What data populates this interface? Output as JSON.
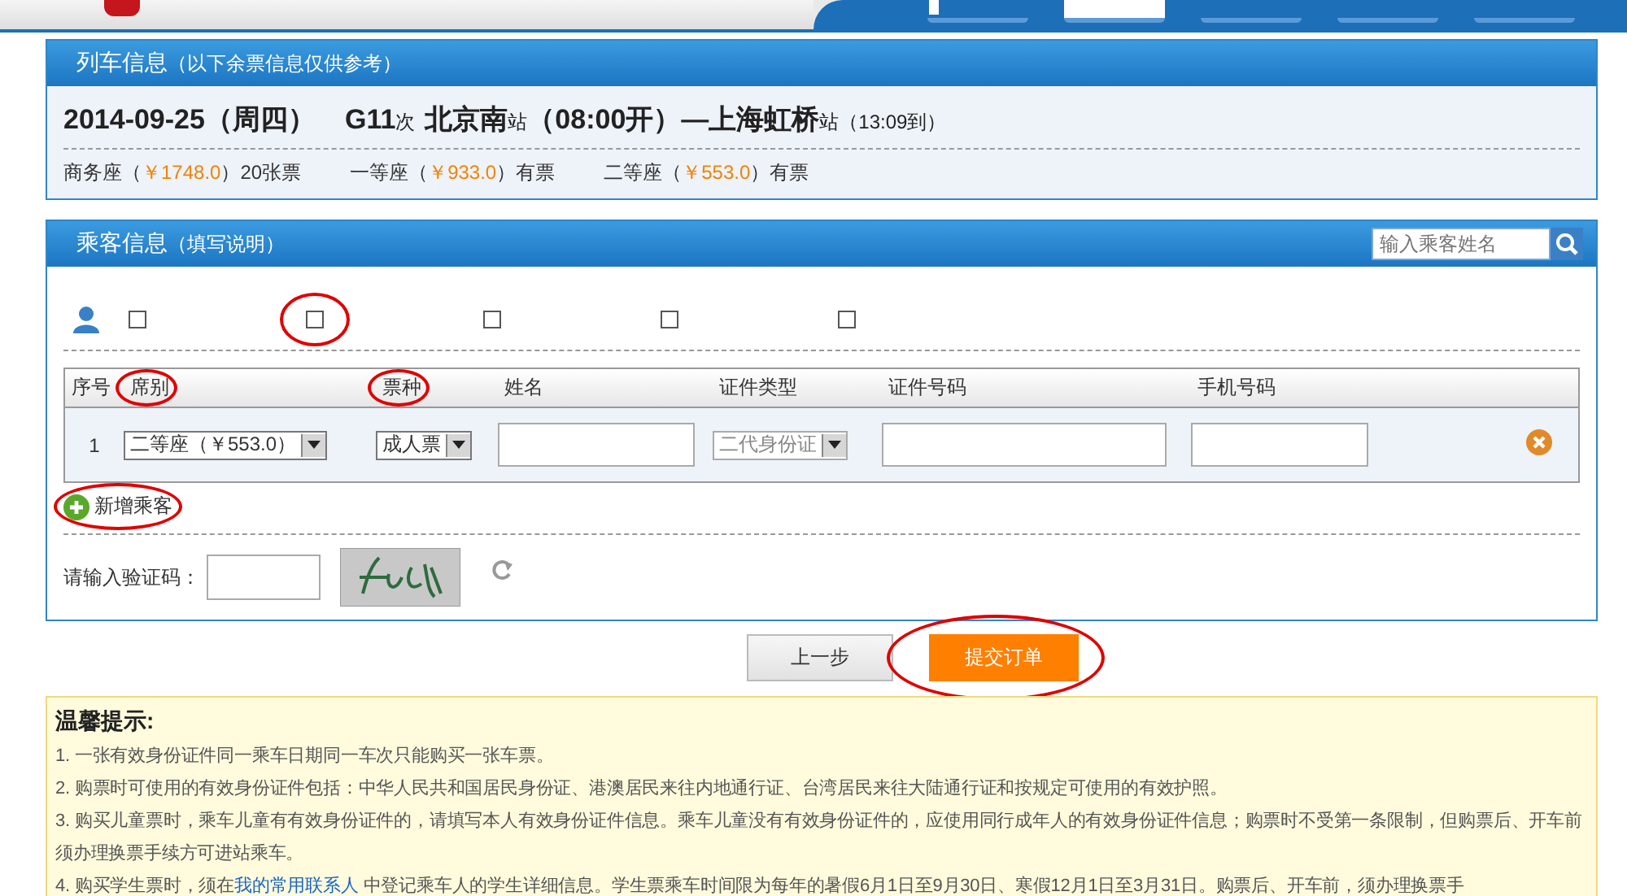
{
  "nav": {
    "tabs": [
      {
        "kind": "home",
        "selected": false
      },
      {
        "kind": "plain",
        "selected": true
      },
      {
        "kind": "plain",
        "selected": false
      },
      {
        "kind": "plain",
        "selected": false
      },
      {
        "kind": "plain",
        "selected": false
      }
    ]
  },
  "train_panel": {
    "title": "列车信息",
    "note": "（以下余票信息仅供参考）",
    "train": {
      "date": "2014-09-25（周四）",
      "number": "G11",
      "number_suffix": "次",
      "from": "北京南",
      "station_suffix": "站",
      "depart": "（08:00开）—",
      "to": "上海虹桥",
      "to_suffix": "站",
      "arrive": "（13:09到）"
    },
    "seats": [
      {
        "name": "商务座（",
        "price": "￥1748.0",
        "close": "）",
        "availability": "20张票"
      },
      {
        "name": "一等座（",
        "price": "￥933.0",
        "close": "）",
        "availability": "有票"
      },
      {
        "name": "二等座（",
        "price": "￥553.0",
        "close": "）",
        "availability": "有票"
      }
    ]
  },
  "passenger_panel": {
    "title": "乘客信息",
    "note": "（填写说明）",
    "search": {
      "placeholder": "输入乘客姓名"
    },
    "contacts": [
      {
        "checked": false,
        "circled": false
      },
      {
        "checked": false,
        "circled": true
      },
      {
        "checked": false,
        "circled": false
      },
      {
        "checked": false,
        "circled": false
      },
      {
        "checked": false,
        "circled": false
      }
    ],
    "columns": [
      {
        "label": "序号",
        "circled": false
      },
      {
        "label": "席别",
        "circled": true
      },
      {
        "label": "票种",
        "circled": true
      },
      {
        "label": "姓名",
        "circled": false
      },
      {
        "label": "证件类型",
        "circled": false
      },
      {
        "label": "证件号码",
        "circled": false
      },
      {
        "label": "手机号码",
        "circled": false
      }
    ],
    "rows": [
      {
        "index": "1",
        "seat": "二等座（￥553.0）",
        "ticket_type": "成人票",
        "id_type": {
          "value": "二代身份证",
          "disabled": true
        }
      }
    ],
    "add_passenger": {
      "label": "新增乘客",
      "circled": true
    },
    "captcha": {
      "label": "请输入验证码："
    }
  },
  "buttons": [
    {
      "label": "上一步",
      "kind": "secondary",
      "circled": false
    },
    {
      "label": "提交订单",
      "kind": "primary",
      "circled": true
    }
  ],
  "tips": {
    "title": "温馨提示:",
    "items": [
      {
        "text": "1. 一张有效身份证件同一乘车日期同一车次只能购买一张车票。"
      },
      {
        "text": "2. 购票时可使用的有效身份证件包括：中华人民共和国居民身份证、港澳居民来往内地通行证、台湾居民来往大陆通行证和按规定可使用的有效护照。"
      },
      {
        "text": "3. 购买儿童票时，乘车儿童有有效身份证件的，请填写本人有效身份证件信息。乘车儿童没有有效身份证件的，应使用同行成年人的有效身份证件信息；购票时不受第一条限制，但购票后、开车前须办理换票手续方可进站乘车。"
      },
      {
        "text": "4. 购买学生票时，须在",
        "link": "我的常用联系人",
        "after": " 中登记乘车人的学生详细信息。学生票乘车时间限为每年的暑假6月1日至9月30日、寒假12月1日至3月31日。购票后、开车前，须办理换票手"
      }
    ]
  }
}
